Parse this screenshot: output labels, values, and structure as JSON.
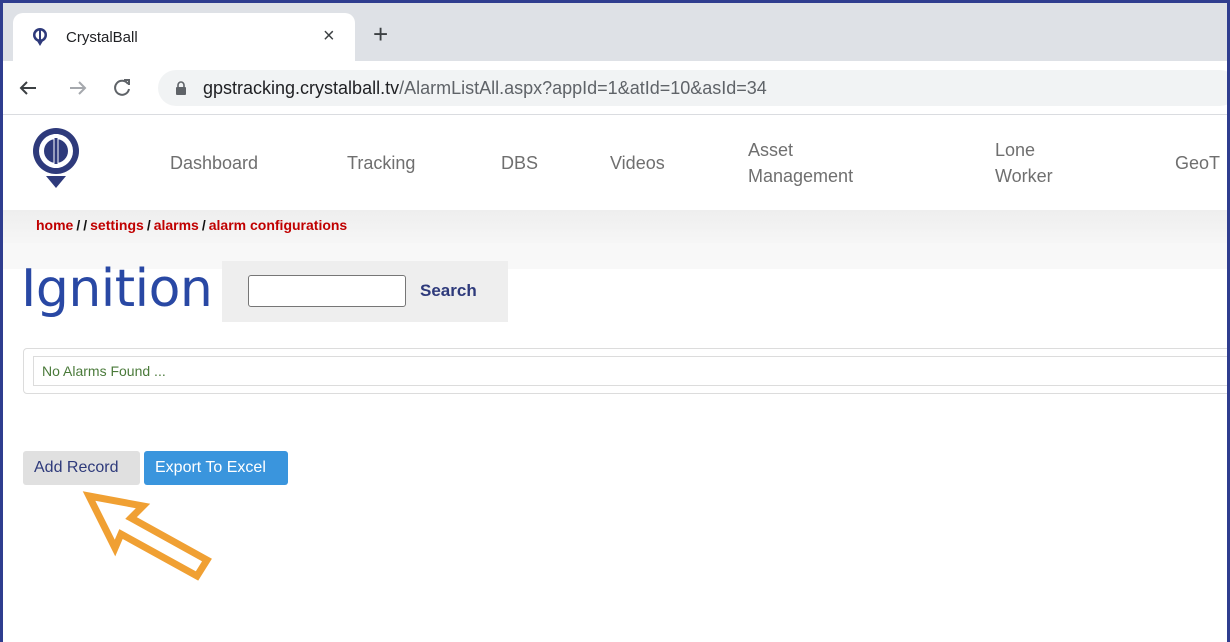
{
  "browser": {
    "tab_title": "CrystalBall",
    "close_glyph": "×",
    "new_tab_glyph": "+",
    "url_host": "gpstracking.crystalball.tv",
    "url_path": "/AlarmListAll.aspx?appId=1&atId=10&asId=34"
  },
  "nav": {
    "items": [
      {
        "label": "Dashboard"
      },
      {
        "label": "Tracking"
      },
      {
        "label": "DBS"
      },
      {
        "label": "Videos"
      },
      {
        "label_line1": "Asset",
        "label_line2": "Management"
      },
      {
        "label_line1": "Lone",
        "label_line2": "Worker"
      },
      {
        "label": "GeoT"
      }
    ]
  },
  "breadcrumb": {
    "home": "home",
    "sep": "/",
    "settings": "settings",
    "alarms": "alarms",
    "alarm_configurations": "alarm configurations"
  },
  "page": {
    "title": "Ignition",
    "search_label": "Search",
    "search_value": "",
    "empty_message": "No Alarms Found ..."
  },
  "actions": {
    "add_record": "Add Record",
    "export_excel": "Export To Excel"
  },
  "colors": {
    "accent": "#2948a4",
    "breadcrumb": "#c00000",
    "export_button": "#3a95dd",
    "pointer_arrow": "#f0a033"
  },
  "icons": [
    "crystalball-favicon",
    "close-icon",
    "plus-icon",
    "back-arrow-icon",
    "forward-arrow-icon",
    "reload-icon",
    "lock-icon",
    "crystalball-logo",
    "pointer-arrow-icon"
  ]
}
